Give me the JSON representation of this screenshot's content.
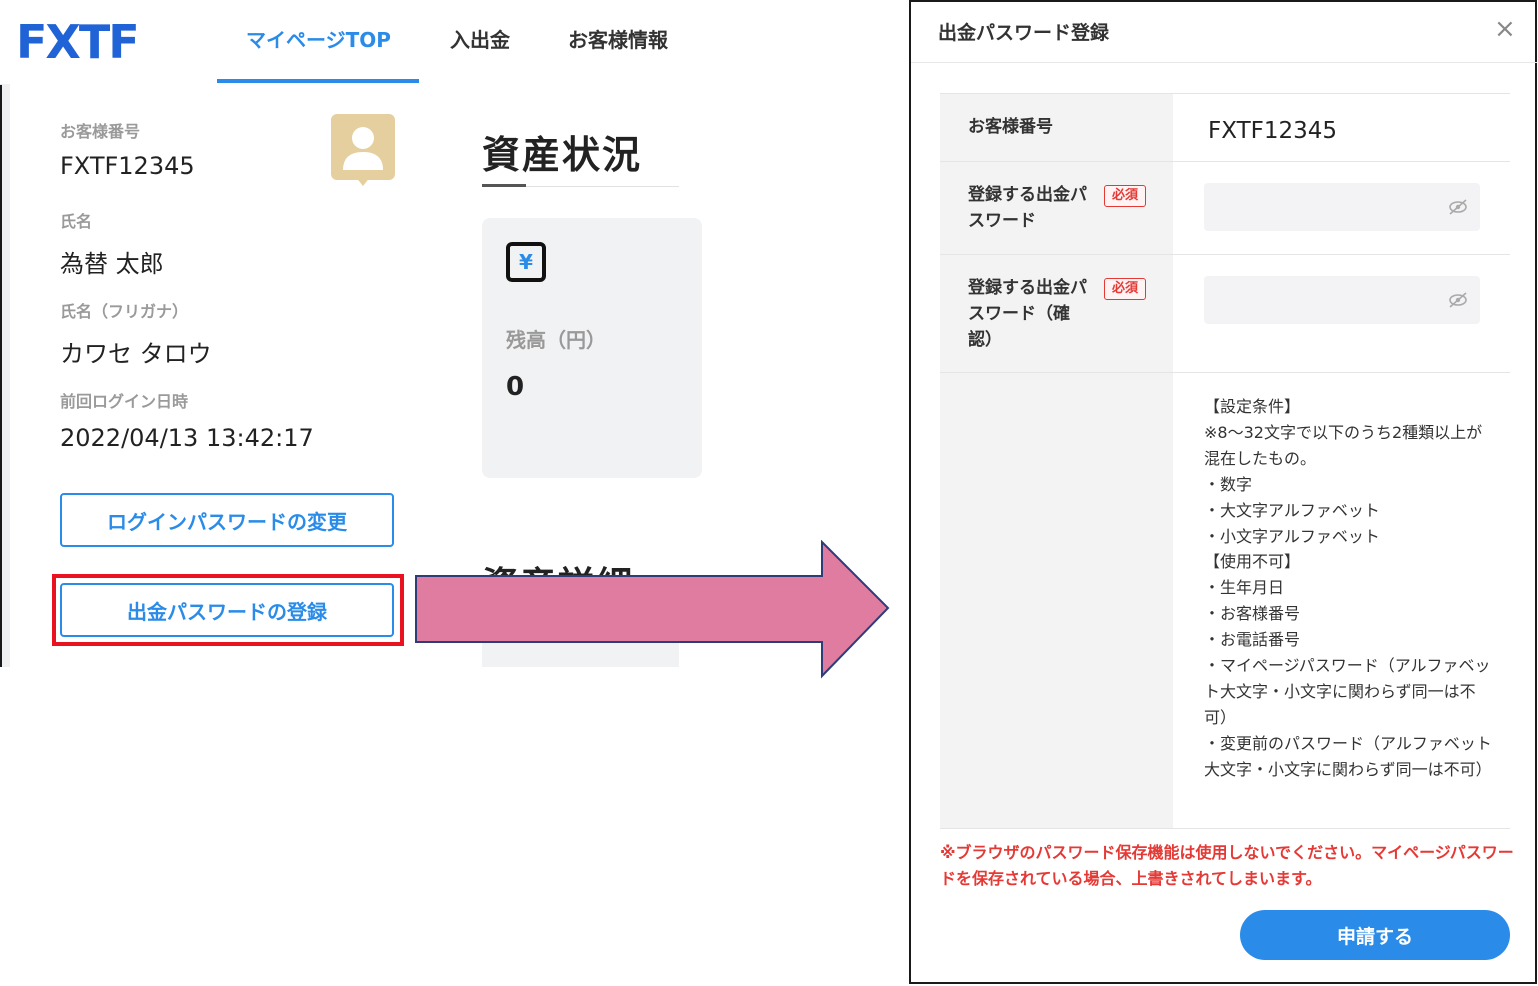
{
  "left": {
    "logo_text": "FXTF",
    "nav": {
      "top": "マイページTOP",
      "deposit": "入出金",
      "info": "お客様情報"
    },
    "profile": {
      "customer_no_label": "お客様番号",
      "customer_no": "FXTF12345",
      "name_label": "氏名",
      "name": "為替 太郎",
      "kana_label": "氏名（フリガナ）",
      "kana": "カワセ タロウ",
      "last_login_label": "前回ログイン日時",
      "last_login": "2022/04/13 13:42:17"
    },
    "buttons": {
      "change_login_pw": "ログインパスワードの変更",
      "register_withdraw_pw": "出金パスワードの登録"
    },
    "assets": {
      "title": "資産状況",
      "balance_label": "残高（円）",
      "balance": "0",
      "detail_title": "資産詳細",
      "currency_symbol": "¥"
    }
  },
  "modal": {
    "title": "出金パスワード登録",
    "close": "×",
    "rows": {
      "customer_no_label": "お客様番号",
      "customer_no": "FXTF12345",
      "pw_label_l1": "登録する出金パ",
      "pw_label_l2": "スワード",
      "pw_confirm_l1": "登録する出金パ",
      "pw_confirm_l2": "スワード（確",
      "pw_confirm_l3": "認）",
      "required": "必須"
    },
    "conditions": "【設定条件】\n※8～32文字で以下のうち2種類以上が混在したもの。\n・数字\n・大文字アルファベット\n・小文字アルファベット\n【使用不可】\n・生年月日\n・お客様番号\n・お電話番号\n・マイページパスワード（アルファベット大文字・小文字に関わらず同一は不可）\n・変更前のパスワード（アルファベット大文字・小文字に関わらず同一は不可）",
    "notice": "※ブラウザのパスワード保存機能は使用しないでください。マイページパスワードを保存されている場合、上書きされてしまいます。",
    "submit": "申請する"
  },
  "colors": {
    "accent": "#2a8be8",
    "highlight": "#e8131f",
    "arrow": "#e07ca0",
    "required": "#e53935"
  },
  "icons": [
    "avatar-icon",
    "yen-icon",
    "close-icon",
    "eye-off-icon",
    "arrow-right"
  ]
}
